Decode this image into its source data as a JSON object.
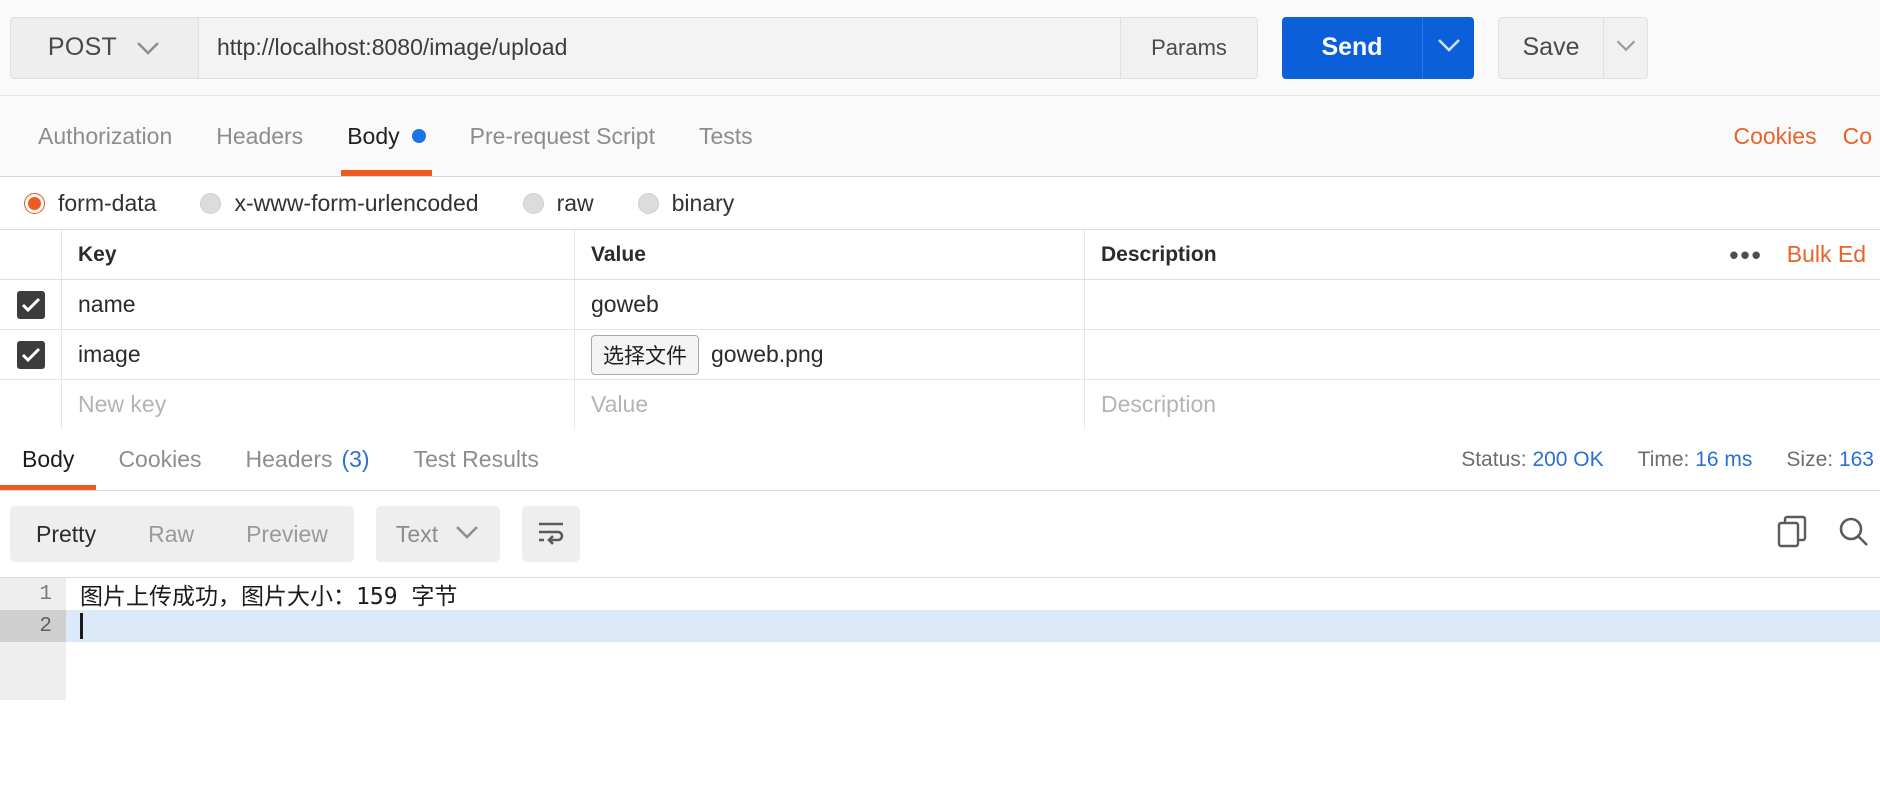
{
  "request_bar": {
    "method": "POST",
    "method_caret_icon": "chevron-down-icon",
    "url": "http://localhost:8080/image/upload",
    "params_label": "Params",
    "send_label": "Send",
    "send_caret_icon": "chevron-down-icon",
    "save_label": "Save",
    "save_caret_icon": "chevron-down-icon",
    "accent_blue": "#0b5fd8"
  },
  "request_tabs": {
    "items": [
      {
        "label": "Authorization",
        "active": false
      },
      {
        "label": "Headers",
        "active": false
      },
      {
        "label": "Body",
        "active": true,
        "dot": true
      },
      {
        "label": "Pre-request Script",
        "active": false
      },
      {
        "label": "Tests",
        "active": false
      }
    ],
    "right_links": [
      {
        "label": "Cookies"
      },
      {
        "label": "Co"
      }
    ],
    "active_underline_color": "#ee5a1f",
    "dot_color": "#1a73e8",
    "link_color": "#e8622c"
  },
  "body_modes": {
    "options": [
      {
        "label": "form-data",
        "selected": true
      },
      {
        "label": "x-www-form-urlencoded",
        "selected": false
      },
      {
        "label": "raw",
        "selected": false
      },
      {
        "label": "binary",
        "selected": false
      }
    ],
    "selected_color": "#ee5a1f"
  },
  "kv_table": {
    "headers": {
      "key": "Key",
      "value": "Value",
      "description": "Description",
      "more_icon": "ellipsis-icon",
      "bulk_edit_label": "Bulk Ed"
    },
    "rows": [
      {
        "checked": true,
        "key": "name",
        "value": "goweb",
        "description": "",
        "is_file": false
      },
      {
        "checked": true,
        "key": "image",
        "file_button_label": "选择文件",
        "value": "goweb.png",
        "description": "",
        "is_file": true
      }
    ],
    "new_row": {
      "key_placeholder": "New key",
      "value_placeholder": "Value",
      "description_placeholder": "Description"
    }
  },
  "response_tabs": {
    "items": [
      {
        "label": "Body",
        "active": true,
        "count": ""
      },
      {
        "label": "Cookies",
        "active": false,
        "count": ""
      },
      {
        "label": "Headers",
        "active": false,
        "count": "(3)"
      },
      {
        "label": "Test Results",
        "active": false,
        "count": ""
      }
    ],
    "meta": {
      "status_label": "Status:",
      "status_value": "200 OK",
      "time_label": "Time:",
      "time_value": "16 ms",
      "size_label": "Size:",
      "size_value": "163"
    }
  },
  "response_toolbar": {
    "view_modes": [
      {
        "label": "Pretty",
        "active": true
      },
      {
        "label": "Raw",
        "active": false
      },
      {
        "label": "Preview",
        "active": false
      }
    ],
    "format": "Text",
    "format_caret_icon": "chevron-down-icon",
    "wrap_icon": "word-wrap-icon",
    "copy_icon": "copy-icon",
    "search_icon": "search-icon"
  },
  "response_body": {
    "lines": [
      {
        "number": "1",
        "text": "图片上传成功，图片大小：159 字节",
        "highlighted": false
      },
      {
        "number": "2",
        "text": "",
        "highlighted": true,
        "caret": true
      }
    ]
  }
}
